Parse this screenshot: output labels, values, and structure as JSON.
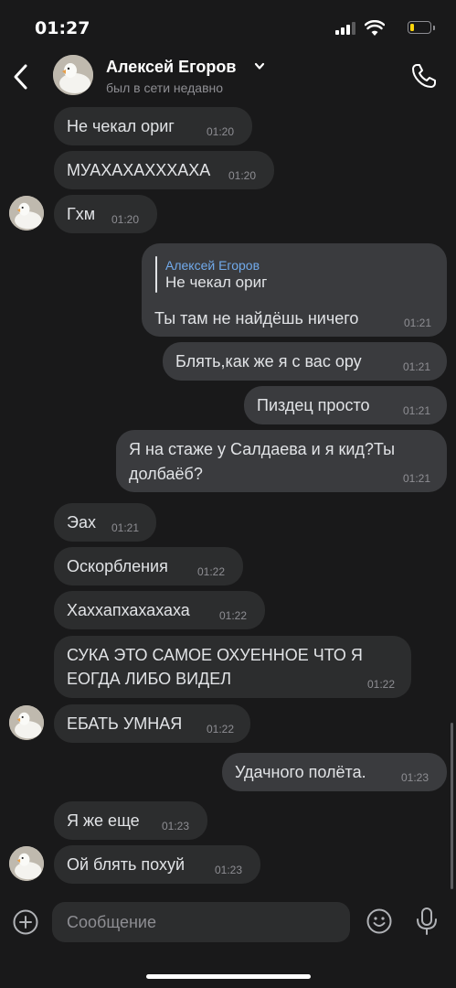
{
  "status_bar": {
    "time": "01:27",
    "battery_level": 0.2
  },
  "header": {
    "name": "Алексей Егоров",
    "status": "был в сети недавно"
  },
  "messages": [
    {
      "text": "Не чекал ориг",
      "time": "01:20"
    },
    {
      "text": "МУАХАХАХХХАХА",
      "time": "01:20"
    },
    {
      "text": "Гхм",
      "time": "01:20"
    },
    {
      "reply_author": "Алексей Егоров",
      "reply_text": "Не чекал ориг",
      "text": "Ты там не найдёшь ничего",
      "time": "01:21"
    },
    {
      "text": "Блять,как же я с вас ору",
      "time": "01:21"
    },
    {
      "text": "Пиздец просто",
      "time": "01:21"
    },
    {
      "line1": "Я на стаже у Салдаева и я кид?Ты",
      "line2": "долбаёб?",
      "time": "01:21"
    },
    {
      "text": "Эах",
      "time": "01:21"
    },
    {
      "text": "Оскорбления",
      "time": "01:22"
    },
    {
      "text": "Хаххапхахахаха",
      "time": "01:22"
    },
    {
      "line1": "СУКА ЭТО САМОЕ ОХУЕННОЕ ЧТО Я",
      "line2": "ЕОГДА ЛИБО ВИДЕЛ",
      "time": "01:22"
    },
    {
      "text": "ЕБАТЬ УМНАЯ",
      "time": "01:22"
    },
    {
      "text": "Удачного полёта.",
      "time": "01:23"
    },
    {
      "text": "Я же еще",
      "time": "01:23"
    },
    {
      "text": "Ой блять похуй",
      "time": "01:23"
    }
  ],
  "composer": {
    "placeholder": "Сообщение"
  },
  "icons": {
    "back": "chevron-left-icon",
    "phone": "phone-icon",
    "attach": "plus-circle-icon",
    "emoji": "smile-icon",
    "voice": "microphone-icon"
  },
  "colors": {
    "background": "#19191a",
    "incoming_bubble": "#2c2d2e",
    "outgoing_bubble": "#3a3b3e",
    "reply_author": "#71aaeb",
    "battery": "#ffd60a"
  }
}
